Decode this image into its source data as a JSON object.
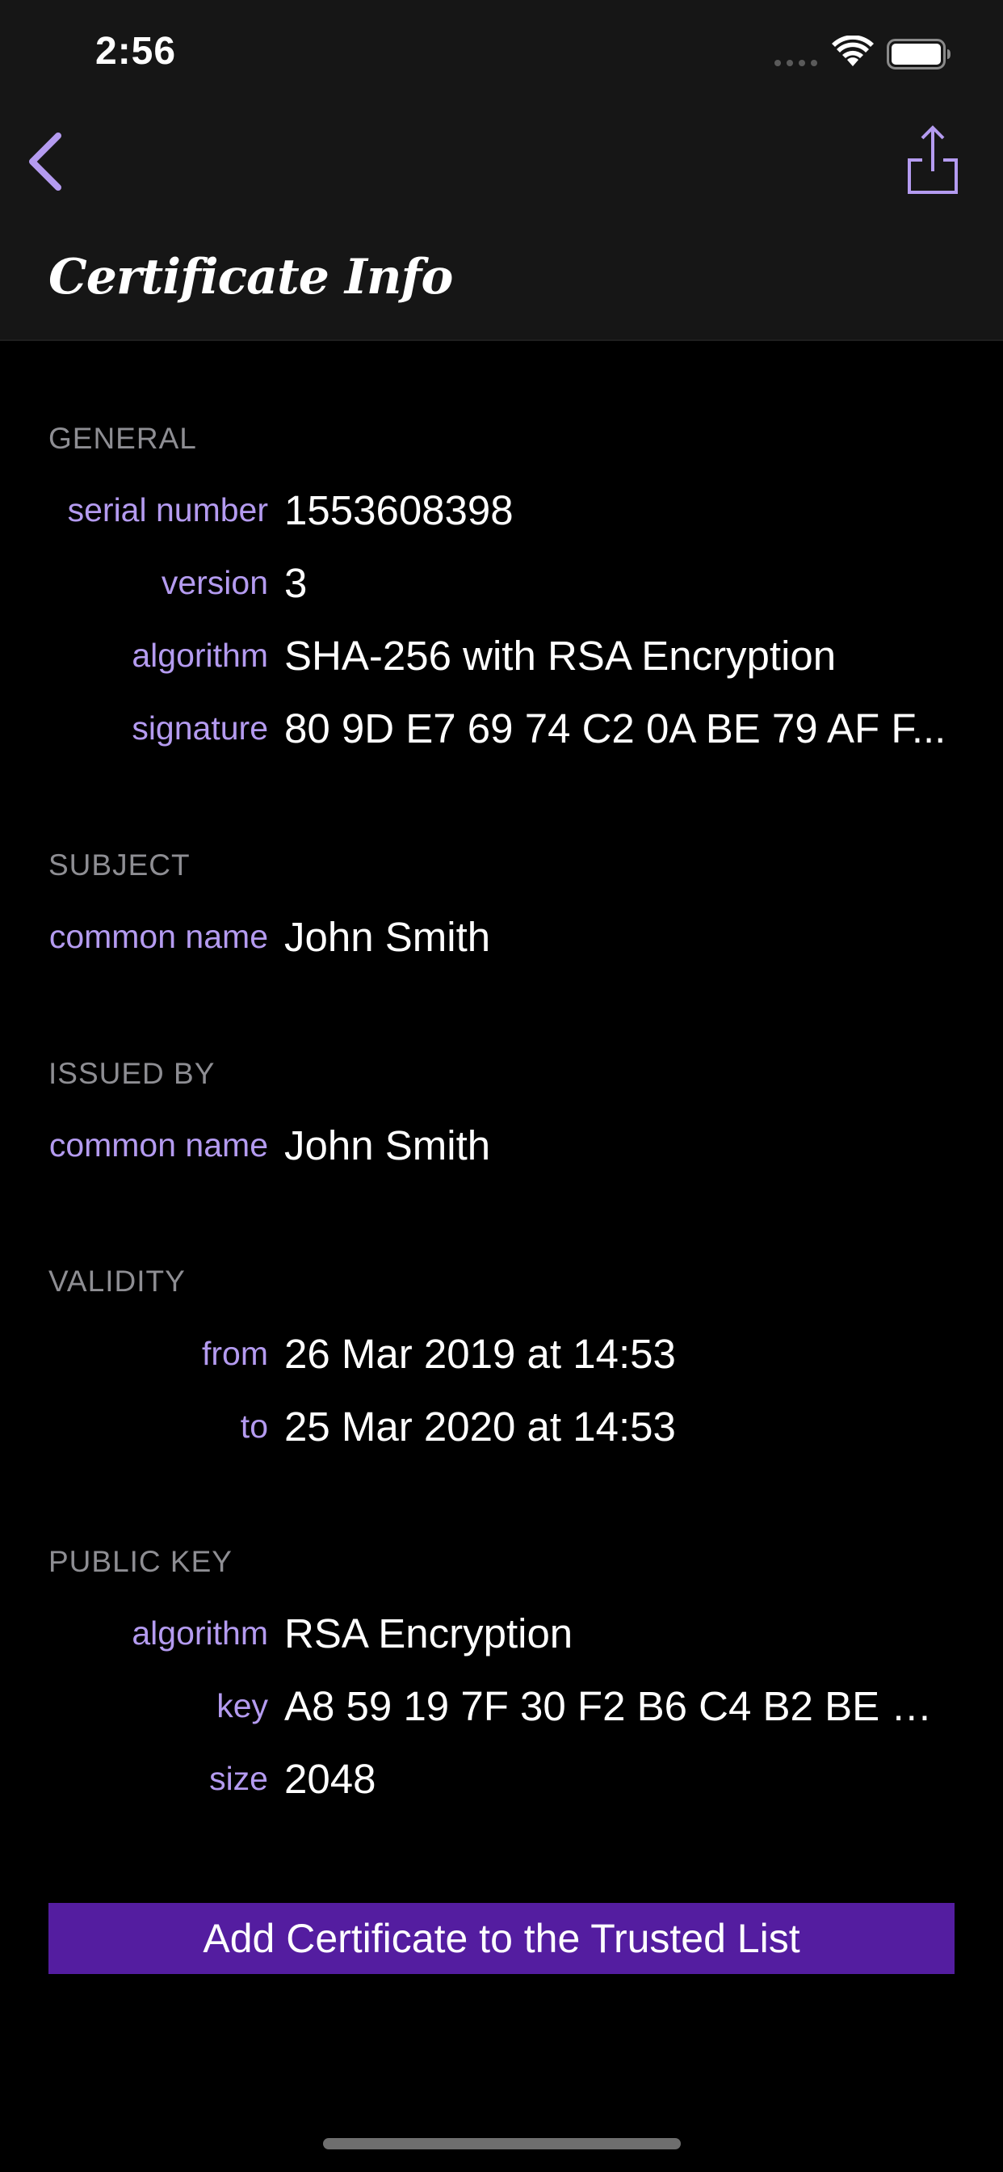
{
  "status_bar": {
    "time": "2:56"
  },
  "nav": {
    "back_icon": "chevron-left-icon",
    "share_icon": "share-icon",
    "title": "Certificate Info"
  },
  "colors": {
    "accent": "#b49bf0",
    "button_bg": "#541da0",
    "header_bg": "#161616",
    "background": "#000000",
    "section_header": "#8e8e93"
  },
  "general": {
    "header": "GENERAL",
    "rows": [
      {
        "label": "serial number",
        "value": "1553608398"
      },
      {
        "label": "version",
        "value": "3"
      },
      {
        "label": "algorithm",
        "value": "SHA-256 with RSA Encryption"
      },
      {
        "label": "signature",
        "value": "80 9D E7 69 74 C2 0A BE 79 AF F..."
      }
    ]
  },
  "subject": {
    "header": "SUBJECT",
    "rows": [
      {
        "label": "common name",
        "value": "John Smith"
      }
    ]
  },
  "issued_by": {
    "header": "ISSUED BY",
    "rows": [
      {
        "label": "common name",
        "value": "John Smith"
      }
    ]
  },
  "validity": {
    "header": "VALIDITY",
    "rows": [
      {
        "label": "from",
        "value": "26 Mar 2019 at 14:53"
      },
      {
        "label": "to",
        "value": "25 Mar 2020 at 14:53"
      }
    ]
  },
  "public_key": {
    "header": "PUBLIC KEY",
    "rows": [
      {
        "label": "algorithm",
        "value": "RSA Encryption"
      },
      {
        "label": "key",
        "value": "A8 59 19 7F 30 F2 B6 C4 B2 BE 4..."
      },
      {
        "label": "size",
        "value": "2048"
      }
    ]
  },
  "actions": {
    "trust_button_label": "Add Certificate to the Trusted List"
  }
}
